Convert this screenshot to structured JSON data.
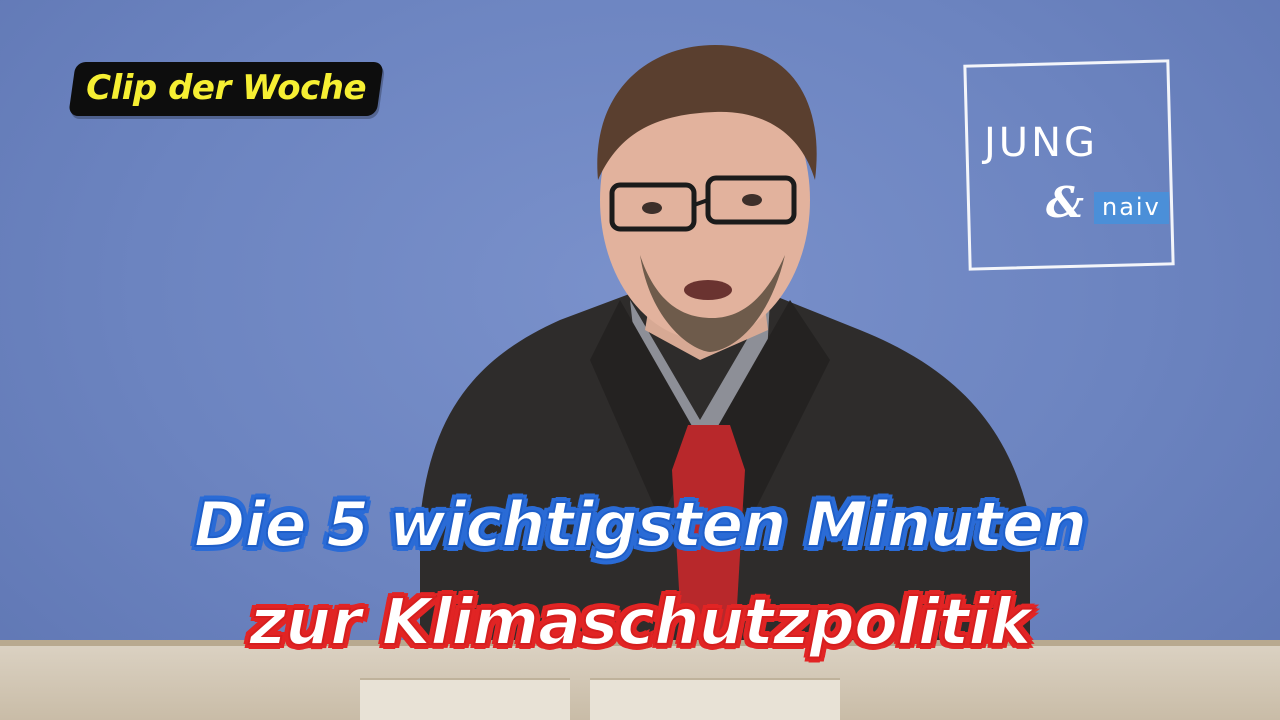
{
  "thumbnail": {
    "clip_label": "Clip der Woche",
    "headline_line1": "Die 5 wichtigsten Minuten",
    "headline_line2": "zur Klimaschutzpolitik",
    "logo": {
      "word1": "JUNG",
      "ampersand": "&",
      "word2": "naiv"
    }
  },
  "colors": {
    "background": "#6f86c2",
    "clip_label_text": "#f6ef33",
    "clip_label_bg": "#0d0d0d",
    "headline1_outline": "#2a6bd6",
    "headline2_outline": "#e12424",
    "logo_accent": "#4b8fd8"
  }
}
